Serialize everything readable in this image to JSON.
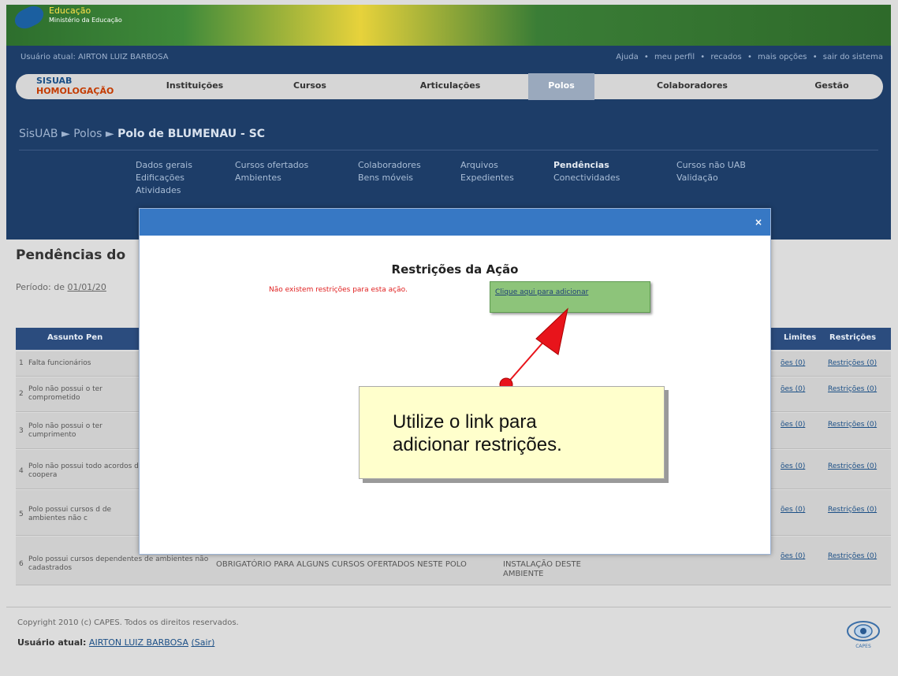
{
  "banner": {
    "title": "Educação",
    "subtitle": "Ministério da Educação"
  },
  "userbar": {
    "left": "Usuário atual: AIRTON LUIZ BARBOSA",
    "links": [
      "Ajuda",
      "•",
      "meu perfil",
      "•",
      "recados",
      "•",
      "mais opções",
      "•",
      "sair do sistema"
    ]
  },
  "nav": {
    "brand": "SISUAB",
    "brand_sub": "HOMOLOGAÇÃO",
    "tabs": [
      "Instituições",
      "Cursos",
      "Articulações",
      "Polos",
      "Colaboradores",
      "Gestão"
    ],
    "active": "Polos"
  },
  "breadcrumb": {
    "root": "SisUAB",
    "sep": "►",
    "level1": "Polos",
    "current": "Polo de BLUMENAU - SC"
  },
  "submenu": {
    "col1": [
      "Dados gerais",
      "Edificações",
      "Atividades"
    ],
    "col2": [
      "Cursos ofertados",
      "Ambientes"
    ],
    "col3": [
      "Colaboradores",
      "Bens móveis"
    ],
    "col4": [
      "Arquivos",
      "Expedientes"
    ],
    "col5": [
      "Pendências",
      "Conectividades"
    ],
    "col6": [
      "Cursos não UAB",
      "Validação"
    ]
  },
  "page": {
    "title": "Pendências do",
    "periodo_label": "Período: de",
    "periodo_value": "01/01/20"
  },
  "table": {
    "headers": [
      "Assunto Pen",
      "Limites",
      "Restrições"
    ],
    "rows": [
      {
        "n": "1",
        "text": "Falta funcionários",
        "l1": "ões (0)",
        "l2": "Restrições (0)"
      },
      {
        "n": "2",
        "text": "Polo não possui o ter comprometido",
        "l1": "ões (0)",
        "l2": "Restrições (0)"
      },
      {
        "n": "3",
        "text": "Polo não possui o ter cumprimento",
        "l1": "ões (0)",
        "l2": "Restrições (0)"
      },
      {
        "n": "4",
        "text": "Polo não possui todo acordos de coopera",
        "l1": "ões (0)",
        "l2": "Restrições (0)"
      },
      {
        "n": "5",
        "text": "Polo possui cursos d de ambientes não c",
        "l1": "ões (0)",
        "l2": "Restrições (0)"
      },
      {
        "n": "6",
        "text": "Polo possui cursos dependentes de ambientes não cadastrados",
        "l1": "ões (0)",
        "l2": "Restrições (0)"
      }
    ],
    "row6_col2": "OBRIGATÓRIO PARA ALGUNS CURSOS OFERTADOS NESTE POLO",
    "row6_col3": "INSTALAÇÃO DESTE AMBIENTE"
  },
  "footer": {
    "copyright": "Copyright 2010 (c) CAPES. Todos os direitos reservados.",
    "user_label": "Usuário atual:",
    "user_name": "AIRTON LUIZ BARBOSA",
    "logout": "(Sair)",
    "logo": "CAPES"
  },
  "modal": {
    "close": "×",
    "title": "Restrições da Ação",
    "message": "Não existem restrições para esta ação.",
    "add_link": "Clique aqui para adicionar"
  },
  "callout": {
    "line1": "Utilize o link para",
    "line2": "adicionar restrições."
  },
  "colors": {
    "navy": "#1d3d68",
    "modal_title": "#3778c4",
    "callout_bg": "#ffffcc",
    "arrow": "#e8141b"
  }
}
